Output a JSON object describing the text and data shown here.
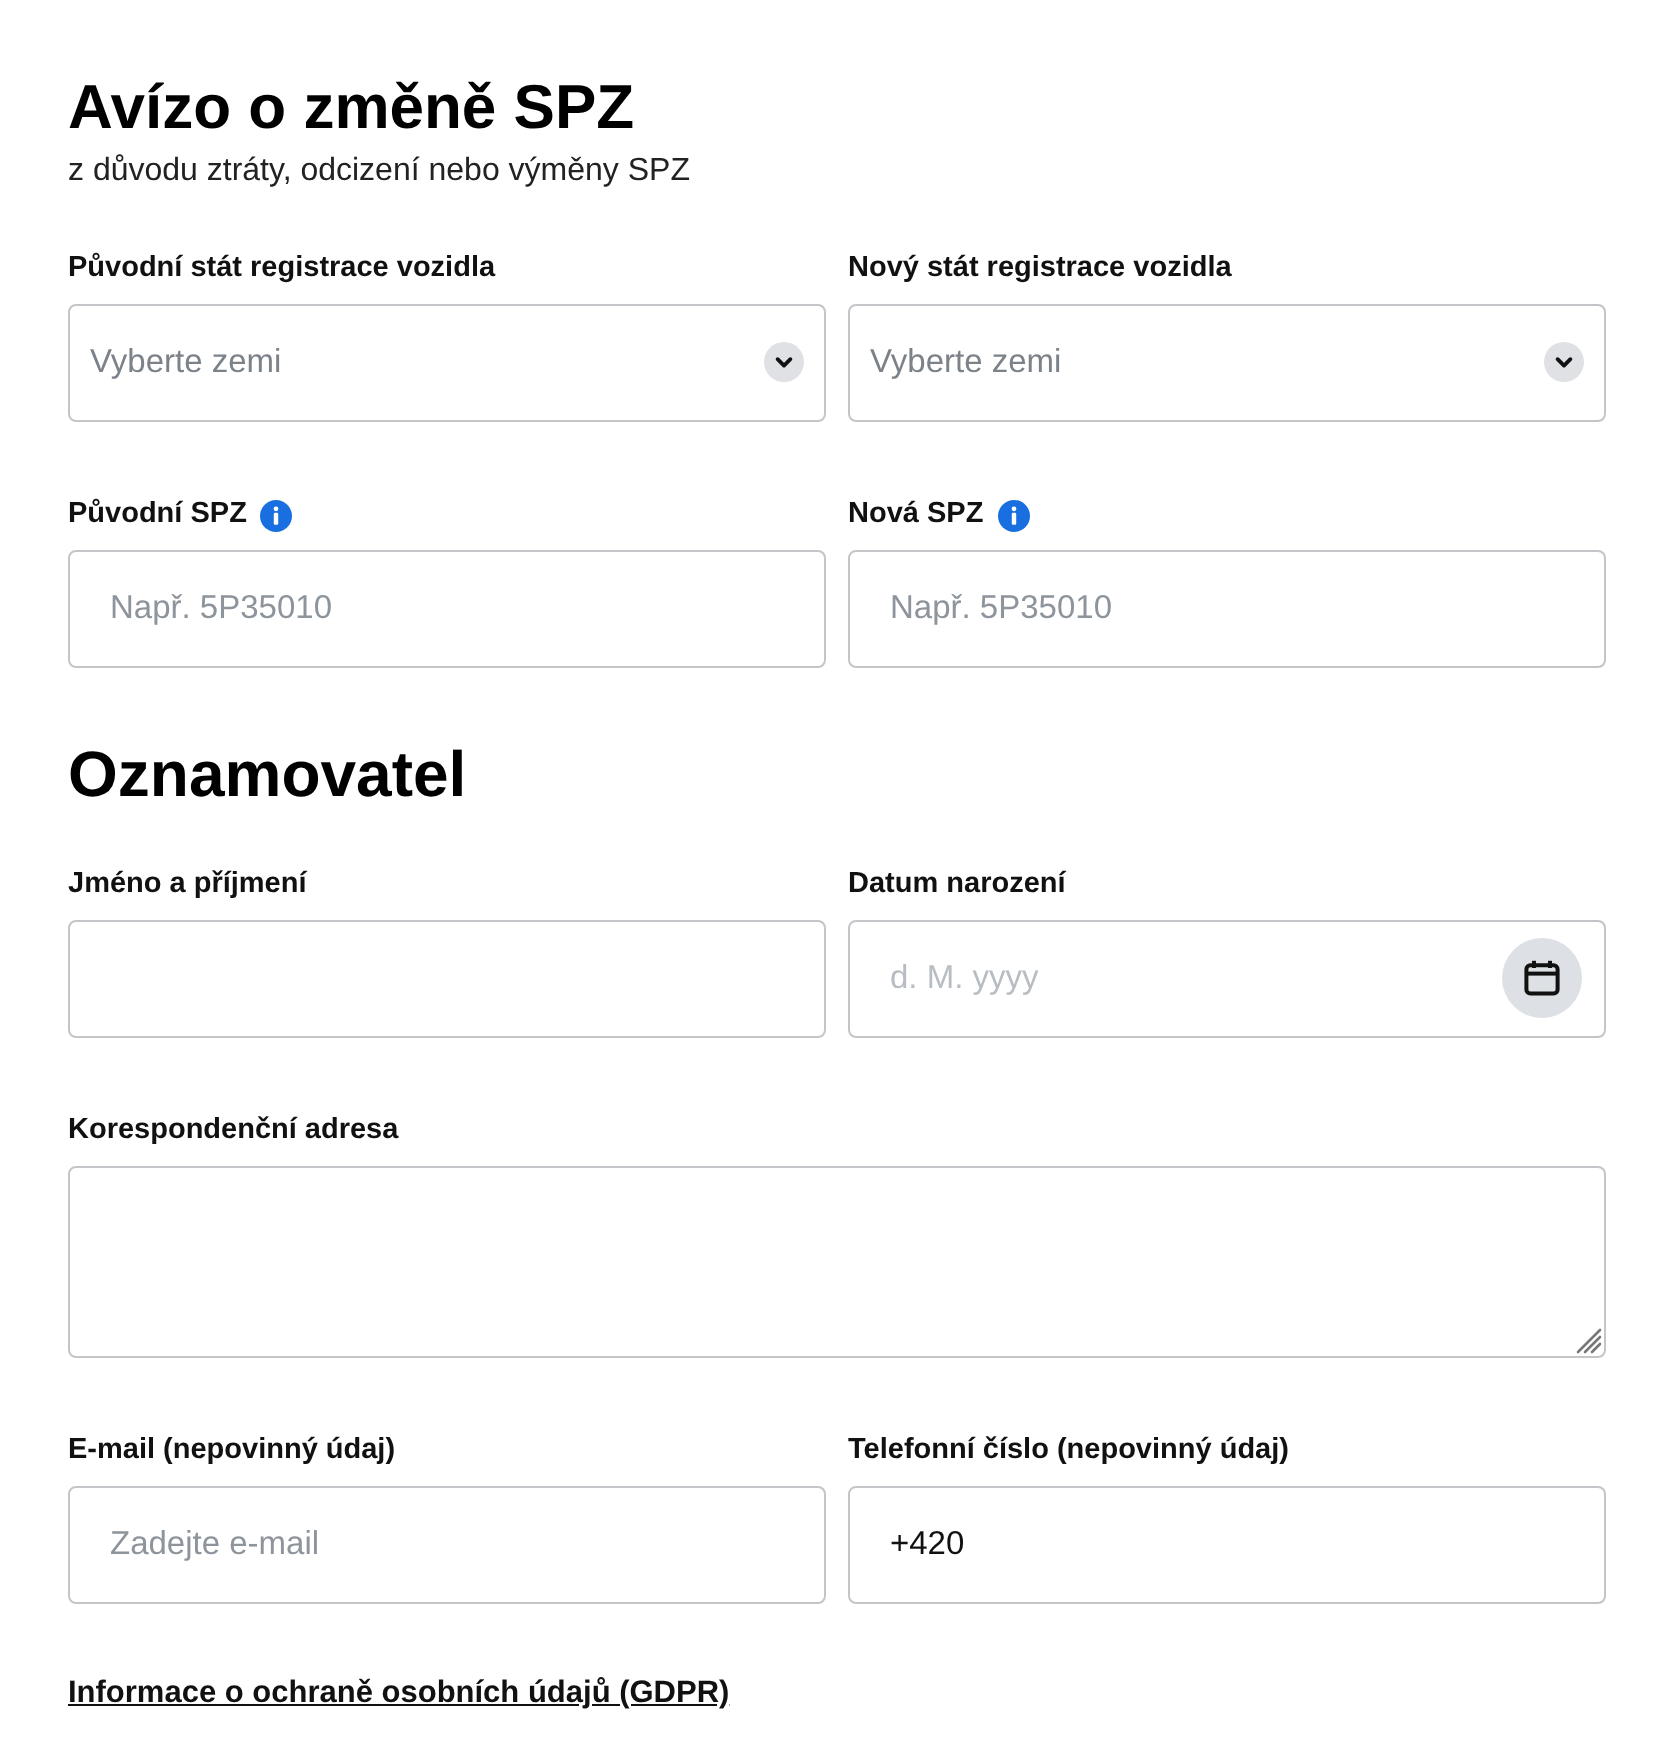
{
  "title": "Avízo o změně SPZ",
  "subtitle": "z důvodu ztráty, odcizení nebo výměny SPZ",
  "vehicle_fields": [
    {
      "label": "Původní stát registrace vozidla",
      "kind": "select",
      "placeholder": "Vyberte zemi",
      "info": false
    },
    {
      "label": "Nový stát registrace vozidla",
      "kind": "select",
      "placeholder": "Vyberte zemi",
      "info": false
    },
    {
      "label": "Původní SPZ",
      "kind": "text",
      "placeholder": "Např. 5P35010",
      "info": true
    },
    {
      "label": "Nová SPZ",
      "kind": "text",
      "placeholder": "Např. 5P35010",
      "info": true
    }
  ],
  "section_heading": "Oznamovatel",
  "reporter_fields": [
    {
      "label": "Jméno a příjmení",
      "kind": "text",
      "info": false
    },
    {
      "label": "Datum narození",
      "kind": "date",
      "placeholder": "d. M. yyyy",
      "info": false
    },
    {
      "label": "Korespondenční adresa",
      "kind": "textarea",
      "info": false
    },
    {
      "label": "E-mail (nepovinný údaj)",
      "kind": "text",
      "placeholder": "Zadejte e-mail",
      "info": false
    },
    {
      "label": "Telefonní číslo (nepovinný údaj)",
      "kind": "text",
      "value": "+420",
      "info": false
    }
  ],
  "gdpr_link": "Informace o ochraně osobních údajů (GDPR)"
}
